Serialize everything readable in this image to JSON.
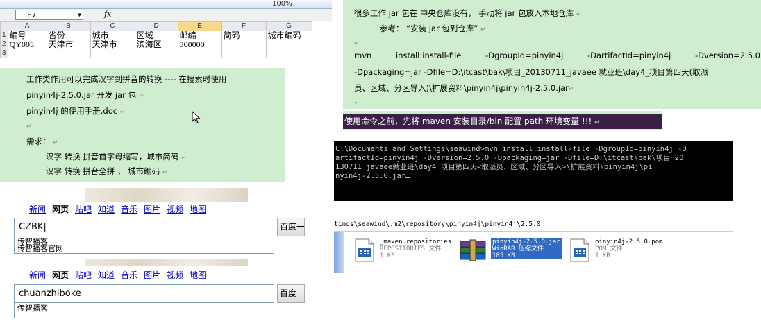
{
  "excel": {
    "toolbar_text": "100%",
    "name_box": "E7",
    "fx": "fx",
    "col_headers": [
      "A",
      "B",
      "C",
      "D",
      "E",
      "F",
      "G"
    ],
    "row_numbers": [
      "1",
      "2",
      "3"
    ],
    "rows": [
      [
        "编号",
        "省份",
        "城市",
        "区域",
        "邮编",
        "简码",
        "城市编码"
      ],
      [
        "QY005",
        "天津市",
        "天津市",
        "滨海区",
        "300000",
        "",
        ""
      ],
      [
        "",
        "",
        "",
        "",
        "",
        "",
        ""
      ]
    ]
  },
  "left_note": {
    "line1": "工作类作用可以完成汉字到拼音的转换 ---- 在搜索时使用",
    "line2": "pinyin4j-2.5.0.jar   开发 jar 包",
    "line3": "pinyin4j 的使用手册.doc",
    "line4": "需求：",
    "line5": "汉字  转换  拼音首字母缩写，城市简码",
    "line6": "汉字  转换  拼音全拼    ，   城市编码",
    "return_mark": "↵"
  },
  "baidu_nav": [
    "新闻",
    "网页",
    "贴吧",
    "知道",
    "音乐",
    "图片",
    "视频",
    "地图"
  ],
  "baidu1": {
    "query": "CZBK",
    "button": "百度一下",
    "suggestion": "传智播客",
    "suggestion2": "传智播客官网"
  },
  "baidu2": {
    "query": "chuanzhiboke",
    "button": "百度一下",
    "suggestion": "传智播客"
  },
  "right_note": {
    "line1": "很多工作 jar 包在 中央仓库没有， 手动将 jar 包放入本地仓库",
    "line2": "参考：  “安装 jar 包到仓库”",
    "line3_words": [
      "mvn",
      "install:install-file",
      "-DgroupId=pinyin4j",
      "-DartifactId=pinyin4j",
      "-Dversion=2.5.0"
    ],
    "line4": "-Dpackaging=jar  -Dfile=D:\\itcast\\bak\\项目_20130711_javaee 就业班\\day4_项目第四天(取派",
    "line5": "员、区域、分区导入)\\扩展资料\\pinyin4j\\pinyin4j-2.5.0.jar",
    "warning": "使用命令之前，先将 maven 安装目录/bin 配置 path 环境变量 !!!"
  },
  "console": {
    "lines": [
      "C:\\Documents and Settings\\seawind>mvn install:install-file -DgroupId=pinyin4j -D",
      "artifactId=pinyin4j -Dversion=2.5.0 -Dpackaging=jar -Dfile=D:\\itcast\\bak\\项目_20",
      "130711_javaee就业班\\day4_项目第四天<取派员、区域、分区导入>\\扩展资料\\pinyin4j\\pi",
      "nyin4j-2.5.0.jar"
    ]
  },
  "explorer": {
    "path": "tings\\seawind\\.m2\\repository\\pinyin4j\\pinyin4j\\2.5.0",
    "files": [
      {
        "name": "_maven.repositories",
        "type": "REPOSITORIES 文件",
        "size": "1 KB",
        "icon": "text-file-icon"
      },
      {
        "name": "pinyin4j-2.5.0.jar",
        "type": "WinRAR 压缩文件",
        "size": "185 KB",
        "icon": "winrar-archive-icon"
      },
      {
        "name": "pinyin4j-2.5.0.pom",
        "type": "POM 文件",
        "size": "1 KB",
        "icon": "text-file-icon"
      }
    ]
  },
  "colors": {
    "note_bg": "#cfedcf",
    "warning_bg": "#3b1f47",
    "link": "#0000cc",
    "selection": "#316ac5"
  }
}
